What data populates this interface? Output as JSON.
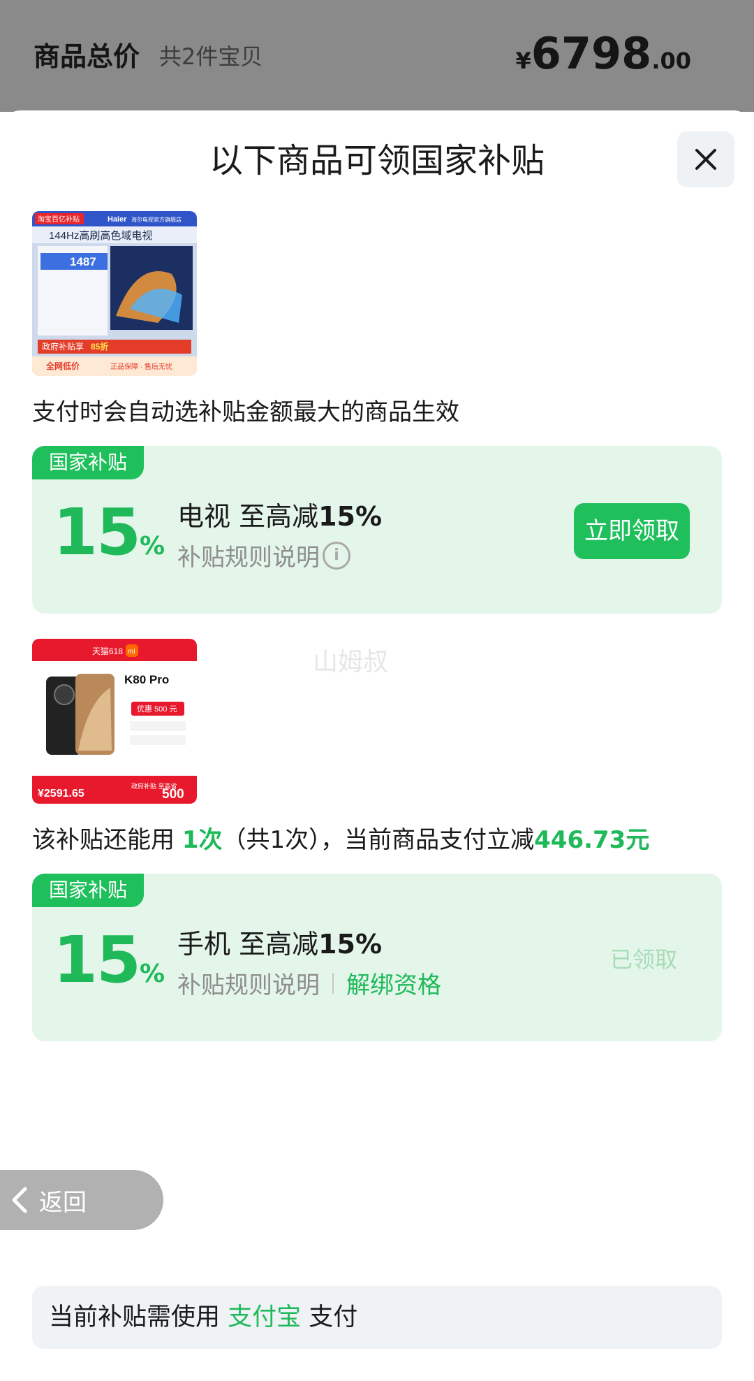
{
  "header": {
    "total_label": "商品总价",
    "item_count": "共2件宝贝",
    "price_symbol": "¥",
    "price_integer": "6798",
    "price_decimal": ".00"
  },
  "sheet": {
    "title": "以下商品可领国家补贴",
    "close_icon": "close-icon"
  },
  "products": [
    {
      "image_text": {
        "banner_left": "淘宝百亿补贴",
        "brand": "Haier",
        "store": "海尔电视官方旗舰店",
        "headline": "144Hz高刷高色域电视",
        "price": "1487",
        "rebate": "政府补贴享",
        "rebate_pct": "85折",
        "footer_left": "全网低价",
        "footer_right": "正品保障 · 售后无忧"
      },
      "note": "支付时会自动选补贴金额最大的商品生效",
      "card": {
        "tag": "国家补贴",
        "pct": "15",
        "pct_symbol": "%",
        "title_prefix": "电视 至高减",
        "title_pct": "15%",
        "rule_label": "补贴规则说明",
        "action": "立即领取"
      }
    },
    {
      "image_text": {
        "store_badge": "天猫618",
        "logo": "mi",
        "model": "K80 Pro",
        "discount": "优惠 500 元",
        "price": "¥2591.65",
        "subsidy_label": "政府补贴 至高省",
        "subsidy_value": "500"
      },
      "note": {
        "part1": "该补贴还能用 ",
        "times": "1次",
        "part2": "（共1次），当前商品支付立减",
        "amount": "446.73元"
      },
      "card": {
        "tag": "国家补贴",
        "pct": "15",
        "pct_symbol": "%",
        "title_prefix": "手机 至高减",
        "title_pct": "15%",
        "rule_label": "补贴规则说明",
        "unbind": "解绑资格",
        "status": "已领取"
      }
    }
  ],
  "watermark": "山姆叔",
  "back": {
    "label": "返回"
  },
  "pay": {
    "prefix": "当前补贴需使用 ",
    "method": "支付宝",
    "suffix": " 支付"
  },
  "colors": {
    "accent": "#1fbf5c",
    "card_bg": "#e4f6ea",
    "header_bg": "#8a8a8a"
  }
}
